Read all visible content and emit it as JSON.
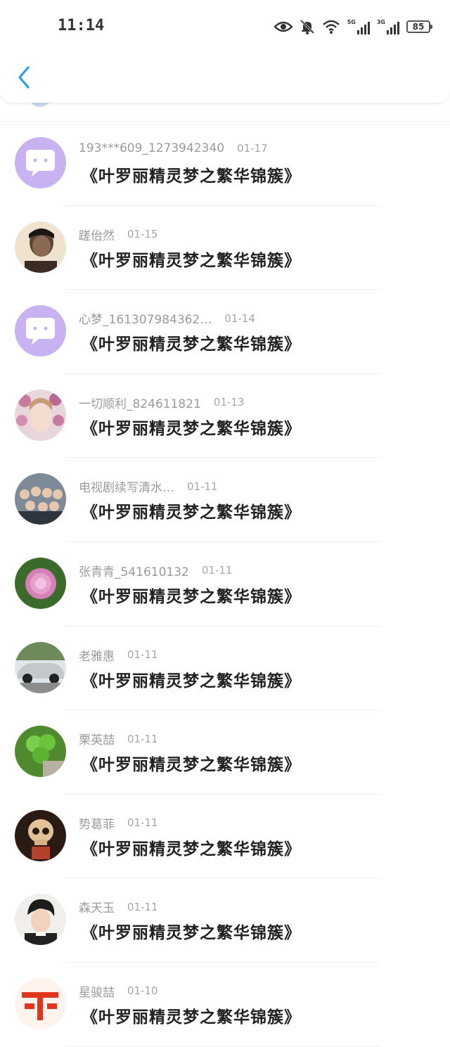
{
  "status_bar": {
    "time": "11:14",
    "battery": "85",
    "network_1": "5G",
    "network_2": "3G",
    "icons": [
      "eye-icon",
      "bell-mute-icon",
      "wifi-icon",
      "signal-5g-icon",
      "signal-3g-icon",
      "battery-icon"
    ]
  },
  "header": {
    "back_icon": "chevron-left-icon",
    "accent_color": "#2b9bf4"
  },
  "comments": [
    {
      "name": "193***609_1273942340",
      "date": "01-17",
      "text": "《叶罗丽精灵梦之繁华锦簇》",
      "avatar": "default-chat-avatar"
    },
    {
      "name": "蹉佁然",
      "date": "01-15",
      "text": "《叶罗丽精灵梦之繁华锦簇》",
      "avatar": "man-portrait-avatar"
    },
    {
      "name": "心梦_161307984362…",
      "date": "01-14",
      "text": "《叶罗丽精灵梦之繁华锦簇》",
      "avatar": "default-chat-avatar"
    },
    {
      "name": "一切顺利_824611821",
      "date": "01-13",
      "text": "《叶罗丽精灵梦之繁华锦簇》",
      "avatar": "flower-crown-girl-avatar"
    },
    {
      "name": "电视剧续写清水…",
      "date": "01-11",
      "text": "《叶罗丽精灵梦之繁华锦簇》",
      "avatar": "group-photo-avatar"
    },
    {
      "name": "张青青_541610132",
      "date": "01-11",
      "text": "《叶罗丽精灵梦之繁华锦簇》",
      "avatar": "peony-flower-avatar"
    },
    {
      "name": "老雅惠",
      "date": "01-11",
      "text": "《叶罗丽精灵梦之繁华锦簇》",
      "avatar": "sports-car-avatar"
    },
    {
      "name": "栗英喆",
      "date": "01-11",
      "text": "《叶罗丽精灵梦之繁华锦簇》",
      "avatar": "clover-avatar"
    },
    {
      "name": "势葛菲",
      "date": "01-11",
      "text": "《叶罗丽精灵梦之繁华锦簇》",
      "avatar": "skull-avatar"
    },
    {
      "name": "森天玉",
      "date": "01-11",
      "text": "《叶罗丽精灵梦之繁华锦簇》",
      "avatar": "young-man-avatar"
    },
    {
      "name": "星骏喆",
      "date": "01-10",
      "text": "《叶罗丽精灵梦之繁华锦簇》",
      "avatar": "red-character-avatar"
    }
  ]
}
